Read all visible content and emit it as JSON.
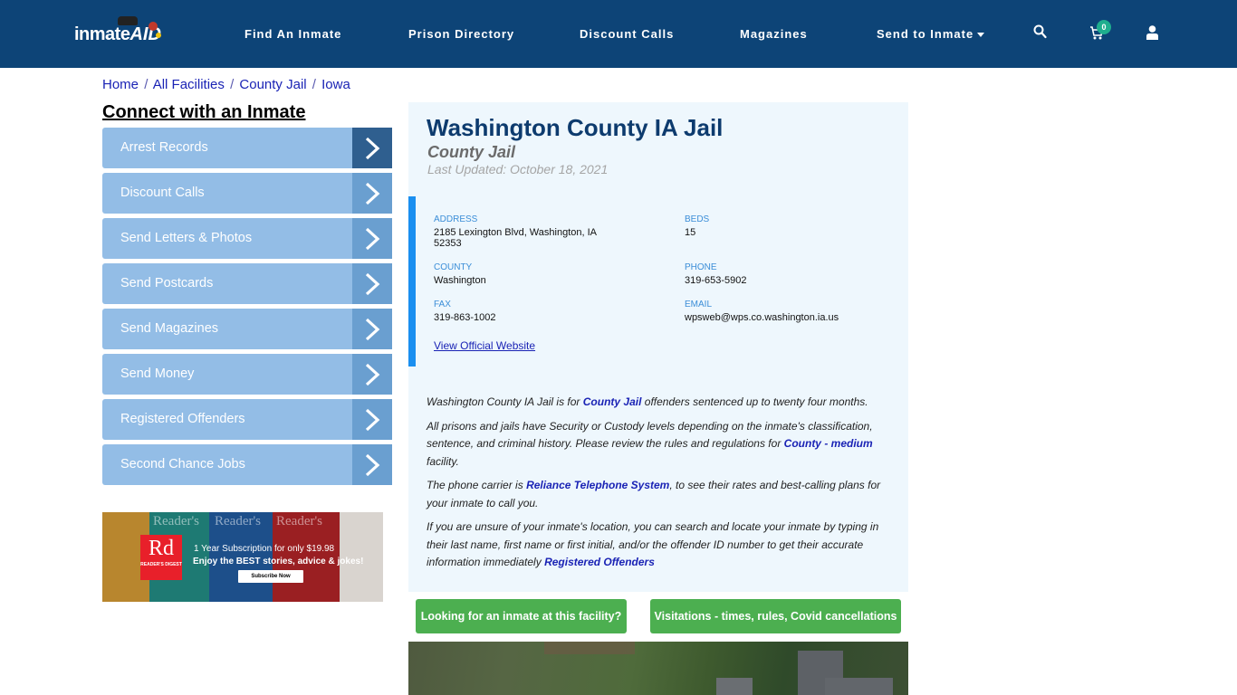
{
  "navbar": {
    "logo": {
      "part1": "inmate",
      "part2": "AID"
    },
    "items": [
      {
        "label": "Find An Inmate"
      },
      {
        "label": "Prison Directory"
      },
      {
        "label": "Discount Calls"
      },
      {
        "label": "Magazines"
      },
      {
        "label": "Send to Inmate"
      }
    ],
    "icons": {
      "search": "search-icon",
      "cart": "cart-icon",
      "user": "user-icon"
    },
    "cart_count": "0"
  },
  "breadcrumb": [
    {
      "label": "Home"
    },
    {
      "label": "All Facilities"
    },
    {
      "label": "County Jail"
    },
    {
      "label": "Iowa"
    }
  ],
  "breadcrumb_sep": "/",
  "sidebar": {
    "title": "Connect with an Inmate",
    "items": [
      {
        "label": "Arrest Records"
      },
      {
        "label": "Discount Calls"
      },
      {
        "label": "Send Letters & Photos"
      },
      {
        "label": "Send Postcards"
      },
      {
        "label": "Send Magazines"
      },
      {
        "label": "Send Money"
      },
      {
        "label": "Registered Offenders"
      },
      {
        "label": "Second Chance Jobs"
      }
    ],
    "ad": {
      "brand": "Rd",
      "brand_sub": "READER'S DIGEST",
      "cover_title": "Reader's",
      "line1": "1 Year Subscription for only $19.98",
      "line2": "Enjoy the BEST stories, advice & jokes!",
      "button": "Subscribe Now"
    }
  },
  "facility": {
    "name": "Washington County IA Jail",
    "type": "County Jail",
    "last_updated": "Last Updated: October 18, 2021",
    "fields": {
      "address": {
        "label": "ADDRESS",
        "value": "2185 Lexington Blvd, Washington, IA 52353"
      },
      "beds": {
        "label": "BEDS",
        "value": "15"
      },
      "county": {
        "label": "COUNTY",
        "value": "Washington"
      },
      "phone": {
        "label": "PHONE",
        "value": "319-653-5902"
      },
      "fax": {
        "label": "FAX",
        "value": "319-863-1002"
      },
      "email": {
        "label": "EMAIL",
        "value": "wpsweb@wps.co.washington.ia.us"
      }
    },
    "official_link": "View Official Website",
    "description": {
      "p1": {
        "pre": "Washington County IA Jail is for ",
        "link": "County Jail",
        "post": " offenders sentenced up to twenty four months."
      },
      "p2": {
        "pre": "All prisons and jails have Security or Custody levels depending on the inmate's classification, sentence, and criminal history. Please review the rules and regulations for ",
        "link": "County - medium",
        "post": " facility."
      },
      "p3": {
        "pre": "The phone carrier is ",
        "link": "Reliance Telephone System",
        "post": ", to see their rates and best-calling plans for your inmate to call you."
      },
      "p4": {
        "pre": "If you are unsure of your inmate's location, you can search and locate your inmate by typing in their last name, first name or first initial, and/or the offender ID number to get their accurate information immediately ",
        "link": "Registered Offenders",
        "post": ""
      }
    }
  },
  "buttons": {
    "find_inmate": "Looking for an inmate at this facility?",
    "visitations": "Visitations - times, rules, Covid cancellations"
  },
  "colors": {
    "navbar": "#0d4477",
    "menu_item": "#93bde6",
    "menu_arrow": "#6a9fd0",
    "menu_arrow_active": "#2f5f8f",
    "panel_bg": "#eef7fd",
    "accent_border": "#1a8ff0",
    "green_button": "#4caf50",
    "title": "#0d3b6e"
  }
}
